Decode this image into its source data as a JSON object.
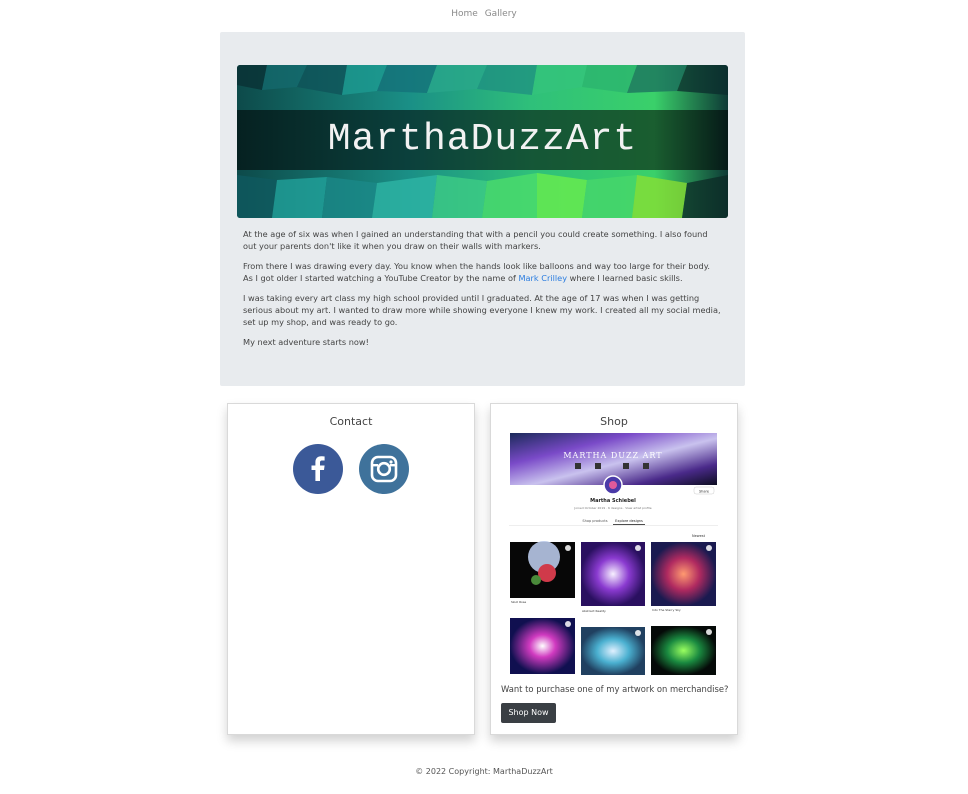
{
  "nav": {
    "links": [
      "Home",
      "Gallery"
    ]
  },
  "banner": {
    "title": "MarthaDuzzArt"
  },
  "bio": {
    "p1": "At the age of six was when I gained an understanding that with a pencil you could create something. I also found out your parents don't like it when you draw on their walls with markers.",
    "p2_before": "From there I was drawing every day. You know when the hands look like balloons and way too large for their body. As I got older I started watching a YouTube Creator by the name of ",
    "p2_link": "Mark Crilley",
    "p2_after": " where I learned basic skills.",
    "p3": "I was taking every art class my high school provided until I graduated. At the age of 17 was when I was getting serious about my art. I wanted to draw more while showing everyone I knew my work. I created all my social media, set up my shop, and was ready to go.",
    "p4": "My next adventure starts now!"
  },
  "contact": {
    "title": "Contact",
    "social": [
      {
        "icon": "facebook-icon",
        "color": "#3b5998"
      },
      {
        "icon": "instagram-icon",
        "color": "#3f729b"
      }
    ]
  },
  "shop": {
    "title": "Shop",
    "preview": {
      "banner_text": "MARTHA DUZZ ART",
      "artist": "Martha Schiebel",
      "meta": "Joined October 2019 · 6 designs · View artist profile",
      "share": "Share",
      "tabs": [
        "Shop products",
        "Explore designs"
      ],
      "sort": "Newest",
      "designs": [
        "Skull Rose",
        "Abstract Reality",
        "Into The Starry Sky"
      ]
    },
    "question": "Want to purchase one of my artwork on merchandise?",
    "button": "Shop Now"
  },
  "footer": {
    "text": "© 2022 Copyright: MarthaDuzzArt"
  },
  "colors": {
    "link": "#2b7de0",
    "jumbotron": "#e8ebee",
    "button": "#3a3f44"
  }
}
